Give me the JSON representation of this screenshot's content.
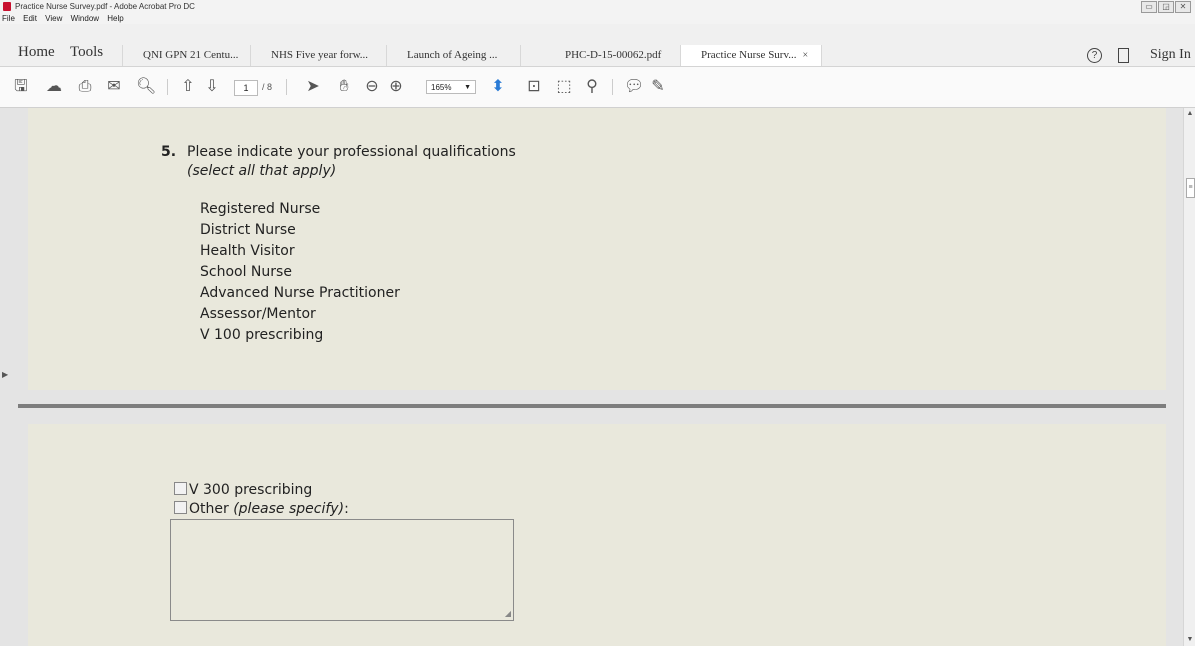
{
  "window": {
    "title": "Practice Nurse Survey.pdf - Adobe Acrobat Pro DC",
    "controls": [
      "▭",
      "◲",
      "✕"
    ]
  },
  "menu": [
    "File",
    "Edit",
    "View",
    "Window",
    "Help"
  ],
  "tabs": {
    "home": "Home",
    "tools": "Tools",
    "documents": [
      {
        "label": "QNI GPN 21 Centu..."
      },
      {
        "label": "NHS Five year forw..."
      },
      {
        "label": "Launch of Ageing ..."
      },
      {
        "label": "PHC-D-15-00062.pdf"
      },
      {
        "label": "Practice Nurse Surv...",
        "close": "×"
      }
    ],
    "sign_in": "Sign In"
  },
  "toolbar": {
    "icons": [
      "save-icon",
      "upload-icon",
      "print-icon",
      "email-icon",
      "search-icon",
      "prev-page-icon",
      "next-page-icon",
      "select-arrow-icon",
      "hand-icon",
      "zoom-out-icon",
      "zoom-in-icon",
      "fit-width-icon",
      "fit-page-icon",
      "fullscreen-icon",
      "stamp-icon",
      "comment-icon",
      "pen-icon"
    ],
    "page_current": "1",
    "page_total": "/ 8",
    "zoom": "165%"
  },
  "page1": {
    "question_number": "5.",
    "question_text": "Please indicate your professional qualifications",
    "question_hint": "(select all that apply)",
    "options": [
      "Registered Nurse",
      "District Nurse",
      "Health Visitor",
      "School Nurse",
      "Advanced Nurse Practitioner",
      "Assessor/Mentor",
      "V 100 prescribing"
    ]
  },
  "page2": {
    "option_v300": "V 300 prescribing",
    "other_label": "Other ",
    "other_hint": "(please specify)",
    "other_colon": ":"
  }
}
